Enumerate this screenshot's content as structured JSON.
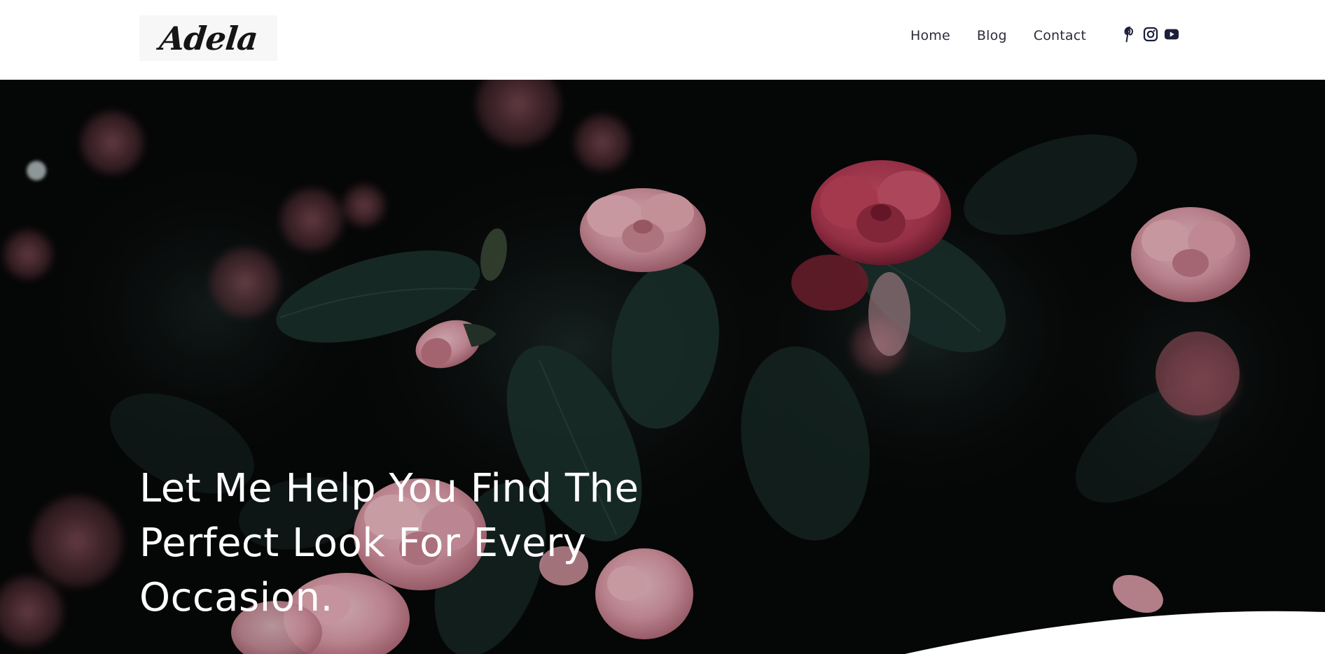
{
  "brand": {
    "logo_text": "Adela"
  },
  "nav": {
    "items": [
      "Home",
      "Blog",
      "Contact"
    ]
  },
  "social": {
    "icons": [
      "pinterest-icon",
      "instagram-icon",
      "youtube-icon"
    ],
    "color": "#1c1f3a"
  },
  "hero": {
    "title": "Let Me Help You Find The Perfect Look For Every Occasion.",
    "overlay_color": "#070808",
    "flower_colors": [
      "#e8a3b0",
      "#c0435c",
      "#f2bcc4"
    ],
    "leaf_color": "#1e3430"
  }
}
